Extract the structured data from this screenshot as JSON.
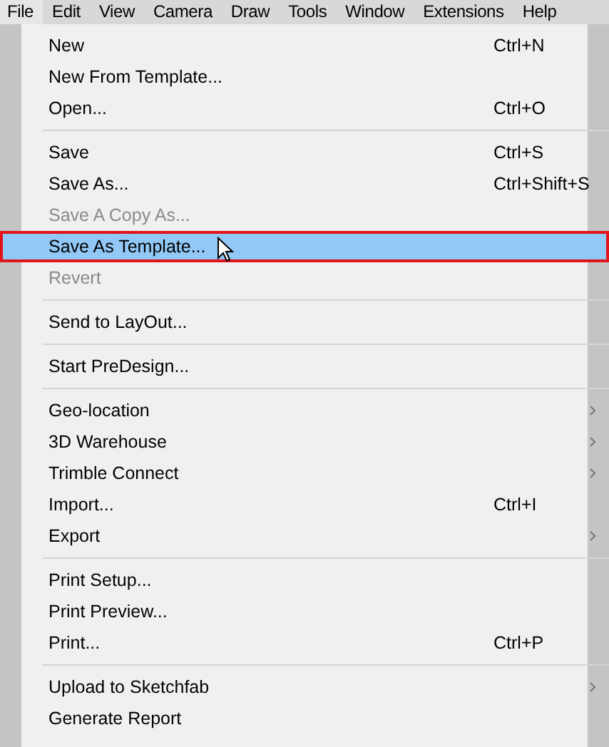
{
  "menubar": [
    {
      "label": "File",
      "selected": true
    },
    {
      "label": "Edit",
      "selected": false
    },
    {
      "label": "View",
      "selected": false
    },
    {
      "label": "Camera",
      "selected": false
    },
    {
      "label": "Draw",
      "selected": false
    },
    {
      "label": "Tools",
      "selected": false
    },
    {
      "label": "Window",
      "selected": false
    },
    {
      "label": "Extensions",
      "selected": false
    },
    {
      "label": "Help",
      "selected": false
    }
  ],
  "menu": {
    "groups": [
      [
        {
          "label": "New",
          "shortcut": "Ctrl+N",
          "disabled": false,
          "submenu": false,
          "selected": false
        },
        {
          "label": "New From Template...",
          "disabled": false,
          "submenu": false,
          "selected": false
        },
        {
          "label": "Open...",
          "shortcut": "Ctrl+O",
          "disabled": false,
          "submenu": false,
          "selected": false
        }
      ],
      [
        {
          "label": "Save",
          "shortcut": "Ctrl+S",
          "disabled": false,
          "submenu": false,
          "selected": false
        },
        {
          "label": "Save As...",
          "shortcut": "Ctrl+Shift+S",
          "disabled": false,
          "submenu": false,
          "selected": false
        },
        {
          "label": "Save A Copy As...",
          "disabled": true,
          "submenu": false,
          "selected": false
        },
        {
          "label": "Save As Template...",
          "disabled": false,
          "submenu": false,
          "selected": true
        },
        {
          "label": "Revert",
          "disabled": true,
          "submenu": false,
          "selected": false
        }
      ],
      [
        {
          "label": "Send to LayOut...",
          "disabled": false,
          "submenu": false,
          "selected": false
        }
      ],
      [
        {
          "label": "Start PreDesign...",
          "disabled": false,
          "submenu": false,
          "selected": false
        }
      ],
      [
        {
          "label": "Geo-location",
          "disabled": false,
          "submenu": true,
          "selected": false
        },
        {
          "label": "3D Warehouse",
          "disabled": false,
          "submenu": true,
          "selected": false
        },
        {
          "label": "Trimble Connect",
          "disabled": false,
          "submenu": true,
          "selected": false
        },
        {
          "label": "Import...",
          "shortcut": "Ctrl+I",
          "disabled": false,
          "submenu": false,
          "selected": false
        },
        {
          "label": "Export",
          "disabled": false,
          "submenu": true,
          "selected": false
        }
      ],
      [
        {
          "label": "Print Setup...",
          "disabled": false,
          "submenu": false,
          "selected": false
        },
        {
          "label": "Print Preview...",
          "disabled": false,
          "submenu": false,
          "selected": false
        },
        {
          "label": "Print...",
          "shortcut": "Ctrl+P",
          "disabled": false,
          "submenu": false,
          "selected": false
        }
      ],
      [
        {
          "label": "Upload to Sketchfab",
          "disabled": false,
          "submenu": true,
          "selected": false
        },
        {
          "label": "Generate Report",
          "disabled": false,
          "submenu": false,
          "selected": false
        }
      ]
    ]
  }
}
